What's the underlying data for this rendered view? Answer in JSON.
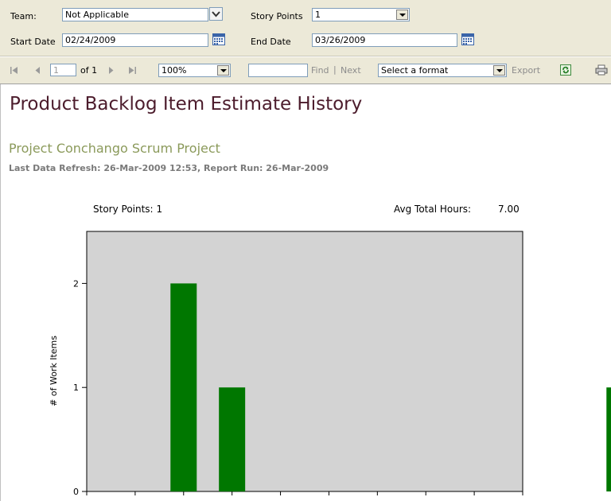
{
  "params": {
    "team_label": "Team:",
    "team_value": "Not Applicable",
    "story_points_label": "Story Points",
    "story_points_value": "1",
    "start_date_label": "Start Date",
    "start_date_value": "02/24/2009",
    "end_date_label": "End Date",
    "end_date_value": "03/26/2009"
  },
  "toolbar": {
    "page_value": "1",
    "page_of": "of 1",
    "zoom_value": "100%",
    "find_value": "",
    "find_label": "Find",
    "separator": "|",
    "next_label": "Next",
    "format_value": "Select a format",
    "export_label": "Export",
    "icons": [
      "first-page-icon",
      "previous-page-icon",
      "next-page-icon",
      "last-page-icon",
      "refresh-icon",
      "print-icon",
      "calendar-icon",
      "chevron-down-icon"
    ]
  },
  "report": {
    "title": "Product Backlog Item Estimate History",
    "project": "Project Conchango Scrum Project",
    "refresh_info": "Last Data Refresh: 26-Mar-2009 12:53, Report Run: 26-Mar-2009",
    "story_points_text": "Story Points:",
    "story_points_value": "1",
    "avg_total_hours_label": "Avg Total Hours:",
    "avg_total_hours_value": "7.00"
  },
  "colors": {
    "panel_bg": "#ece9d8",
    "title": "#4c1c2c",
    "project": "#8b9a5b",
    "plot_bg": "#d3d3d3",
    "bar": "#007700"
  },
  "chart_data": {
    "type": "bar",
    "ylabel": "# of Work Items",
    "xlabel": "",
    "ylim": [
      0,
      2.5
    ],
    "yticks": [
      0,
      1,
      2
    ],
    "x": [
      3,
      4,
      12
    ],
    "values": [
      2,
      1,
      1
    ],
    "xlim": [
      1,
      13
    ],
    "grid": false
  }
}
